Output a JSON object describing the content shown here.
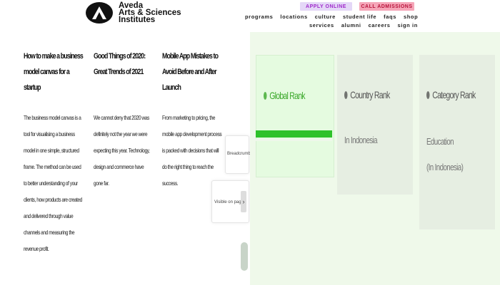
{
  "header": {
    "logo_line1": "Aveda",
    "logo_line2": "Arts & Sciences",
    "logo_line3": "Institutes",
    "apply_label": "APPLY ONLINE",
    "call_label": "CALL ADMISSIONS",
    "nav_row1": [
      "programs",
      "locations",
      "culture",
      "student life",
      "faqs",
      "shop"
    ],
    "nav_row2": [
      "services",
      "alumni",
      "careers",
      "sign in"
    ]
  },
  "articles": [
    {
      "title": "How to make a business model canvas for a startup",
      "body": "The business model canvas is a tool for visualising a business model in one simple, structured frame. The method can be used to better understanding of your clients, how products are created and delivered through value channels and measuring the revenue profit."
    },
    {
      "title": "Good Things of 2020: Great Trends of 2021",
      "body": "We cannot deny that 2020 was definitely not the year we were expecting this year. Technology, design and commerce have gone far."
    },
    {
      "title": "Mobile App Mistakes to Avoid Before and After Launch",
      "body": "From marketing to pricing, the mobile app development process is packed with decisions that will do the right thing to reach the success."
    }
  ],
  "rank_panel": {
    "global_label": "Global Rank",
    "country_label": "Country Rank",
    "country_sub": "In Indonesia",
    "category_label": "Category Rank",
    "category_sub1": "Education",
    "category_sub2": "(In Indonesia)",
    "global_progress": 1.0
  },
  "widgets": {
    "w1_text": "Breadcrumbs",
    "w2_text": "Visible on page",
    "arrow": "›"
  },
  "colors": {
    "apply_bg": "#e4d7f7",
    "call_bg": "#f5a6b8",
    "panel_bg": "#eff9ea",
    "bar_fill": "#2ec22a"
  }
}
